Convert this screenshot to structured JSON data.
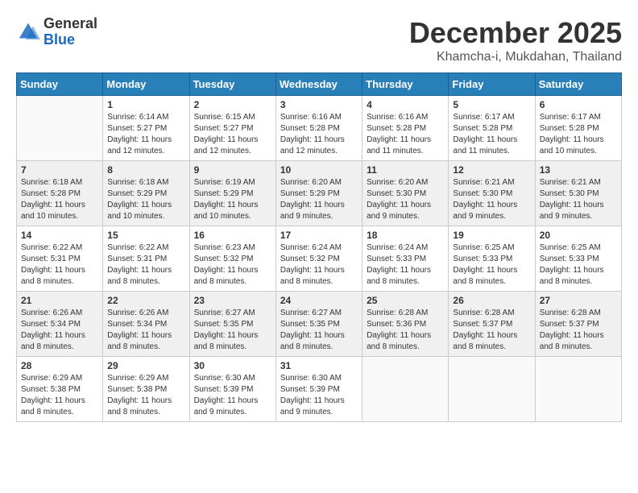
{
  "logo": {
    "general": "General",
    "blue": "Blue"
  },
  "title": "December 2025",
  "location": "Khamcha-i, Mukdahan, Thailand",
  "days_of_week": [
    "Sunday",
    "Monday",
    "Tuesday",
    "Wednesday",
    "Thursday",
    "Friday",
    "Saturday"
  ],
  "weeks": [
    [
      {
        "day": "",
        "sunrise": "",
        "sunset": "",
        "daylight": "",
        "empty": true
      },
      {
        "day": "1",
        "sunrise": "Sunrise: 6:14 AM",
        "sunset": "Sunset: 5:27 PM",
        "daylight": "Daylight: 11 hours and 12 minutes.",
        "empty": false
      },
      {
        "day": "2",
        "sunrise": "Sunrise: 6:15 AM",
        "sunset": "Sunset: 5:27 PM",
        "daylight": "Daylight: 11 hours and 12 minutes.",
        "empty": false
      },
      {
        "day": "3",
        "sunrise": "Sunrise: 6:16 AM",
        "sunset": "Sunset: 5:28 PM",
        "daylight": "Daylight: 11 hours and 12 minutes.",
        "empty": false
      },
      {
        "day": "4",
        "sunrise": "Sunrise: 6:16 AM",
        "sunset": "Sunset: 5:28 PM",
        "daylight": "Daylight: 11 hours and 11 minutes.",
        "empty": false
      },
      {
        "day": "5",
        "sunrise": "Sunrise: 6:17 AM",
        "sunset": "Sunset: 5:28 PM",
        "daylight": "Daylight: 11 hours and 11 minutes.",
        "empty": false
      },
      {
        "day": "6",
        "sunrise": "Sunrise: 6:17 AM",
        "sunset": "Sunset: 5:28 PM",
        "daylight": "Daylight: 11 hours and 10 minutes.",
        "empty": false
      }
    ],
    [
      {
        "day": "7",
        "sunrise": "Sunrise: 6:18 AM",
        "sunset": "Sunset: 5:28 PM",
        "daylight": "Daylight: 11 hours and 10 minutes.",
        "empty": false
      },
      {
        "day": "8",
        "sunrise": "Sunrise: 6:18 AM",
        "sunset": "Sunset: 5:29 PM",
        "daylight": "Daylight: 11 hours and 10 minutes.",
        "empty": false
      },
      {
        "day": "9",
        "sunrise": "Sunrise: 6:19 AM",
        "sunset": "Sunset: 5:29 PM",
        "daylight": "Daylight: 11 hours and 10 minutes.",
        "empty": false
      },
      {
        "day": "10",
        "sunrise": "Sunrise: 6:20 AM",
        "sunset": "Sunset: 5:29 PM",
        "daylight": "Daylight: 11 hours and 9 minutes.",
        "empty": false
      },
      {
        "day": "11",
        "sunrise": "Sunrise: 6:20 AM",
        "sunset": "Sunset: 5:30 PM",
        "daylight": "Daylight: 11 hours and 9 minutes.",
        "empty": false
      },
      {
        "day": "12",
        "sunrise": "Sunrise: 6:21 AM",
        "sunset": "Sunset: 5:30 PM",
        "daylight": "Daylight: 11 hours and 9 minutes.",
        "empty": false
      },
      {
        "day": "13",
        "sunrise": "Sunrise: 6:21 AM",
        "sunset": "Sunset: 5:30 PM",
        "daylight": "Daylight: 11 hours and 9 minutes.",
        "empty": false
      }
    ],
    [
      {
        "day": "14",
        "sunrise": "Sunrise: 6:22 AM",
        "sunset": "Sunset: 5:31 PM",
        "daylight": "Daylight: 11 hours and 8 minutes.",
        "empty": false
      },
      {
        "day": "15",
        "sunrise": "Sunrise: 6:22 AM",
        "sunset": "Sunset: 5:31 PM",
        "daylight": "Daylight: 11 hours and 8 minutes.",
        "empty": false
      },
      {
        "day": "16",
        "sunrise": "Sunrise: 6:23 AM",
        "sunset": "Sunset: 5:32 PM",
        "daylight": "Daylight: 11 hours and 8 minutes.",
        "empty": false
      },
      {
        "day": "17",
        "sunrise": "Sunrise: 6:24 AM",
        "sunset": "Sunset: 5:32 PM",
        "daylight": "Daylight: 11 hours and 8 minutes.",
        "empty": false
      },
      {
        "day": "18",
        "sunrise": "Sunrise: 6:24 AM",
        "sunset": "Sunset: 5:33 PM",
        "daylight": "Daylight: 11 hours and 8 minutes.",
        "empty": false
      },
      {
        "day": "19",
        "sunrise": "Sunrise: 6:25 AM",
        "sunset": "Sunset: 5:33 PM",
        "daylight": "Daylight: 11 hours and 8 minutes.",
        "empty": false
      },
      {
        "day": "20",
        "sunrise": "Sunrise: 6:25 AM",
        "sunset": "Sunset: 5:33 PM",
        "daylight": "Daylight: 11 hours and 8 minutes.",
        "empty": false
      }
    ],
    [
      {
        "day": "21",
        "sunrise": "Sunrise: 6:26 AM",
        "sunset": "Sunset: 5:34 PM",
        "daylight": "Daylight: 11 hours and 8 minutes.",
        "empty": false
      },
      {
        "day": "22",
        "sunrise": "Sunrise: 6:26 AM",
        "sunset": "Sunset: 5:34 PM",
        "daylight": "Daylight: 11 hours and 8 minutes.",
        "empty": false
      },
      {
        "day": "23",
        "sunrise": "Sunrise: 6:27 AM",
        "sunset": "Sunset: 5:35 PM",
        "daylight": "Daylight: 11 hours and 8 minutes.",
        "empty": false
      },
      {
        "day": "24",
        "sunrise": "Sunrise: 6:27 AM",
        "sunset": "Sunset: 5:35 PM",
        "daylight": "Daylight: 11 hours and 8 minutes.",
        "empty": false
      },
      {
        "day": "25",
        "sunrise": "Sunrise: 6:28 AM",
        "sunset": "Sunset: 5:36 PM",
        "daylight": "Daylight: 11 hours and 8 minutes.",
        "empty": false
      },
      {
        "day": "26",
        "sunrise": "Sunrise: 6:28 AM",
        "sunset": "Sunset: 5:37 PM",
        "daylight": "Daylight: 11 hours and 8 minutes.",
        "empty": false
      },
      {
        "day": "27",
        "sunrise": "Sunrise: 6:28 AM",
        "sunset": "Sunset: 5:37 PM",
        "daylight": "Daylight: 11 hours and 8 minutes.",
        "empty": false
      }
    ],
    [
      {
        "day": "28",
        "sunrise": "Sunrise: 6:29 AM",
        "sunset": "Sunset: 5:38 PM",
        "daylight": "Daylight: 11 hours and 8 minutes.",
        "empty": false
      },
      {
        "day": "29",
        "sunrise": "Sunrise: 6:29 AM",
        "sunset": "Sunset: 5:38 PM",
        "daylight": "Daylight: 11 hours and 8 minutes.",
        "empty": false
      },
      {
        "day": "30",
        "sunrise": "Sunrise: 6:30 AM",
        "sunset": "Sunset: 5:39 PM",
        "daylight": "Daylight: 11 hours and 9 minutes.",
        "empty": false
      },
      {
        "day": "31",
        "sunrise": "Sunrise: 6:30 AM",
        "sunset": "Sunset: 5:39 PM",
        "daylight": "Daylight: 11 hours and 9 minutes.",
        "empty": false
      },
      {
        "day": "",
        "sunrise": "",
        "sunset": "",
        "daylight": "",
        "empty": true
      },
      {
        "day": "",
        "sunrise": "",
        "sunset": "",
        "daylight": "",
        "empty": true
      },
      {
        "day": "",
        "sunrise": "",
        "sunset": "",
        "daylight": "",
        "empty": true
      }
    ]
  ]
}
